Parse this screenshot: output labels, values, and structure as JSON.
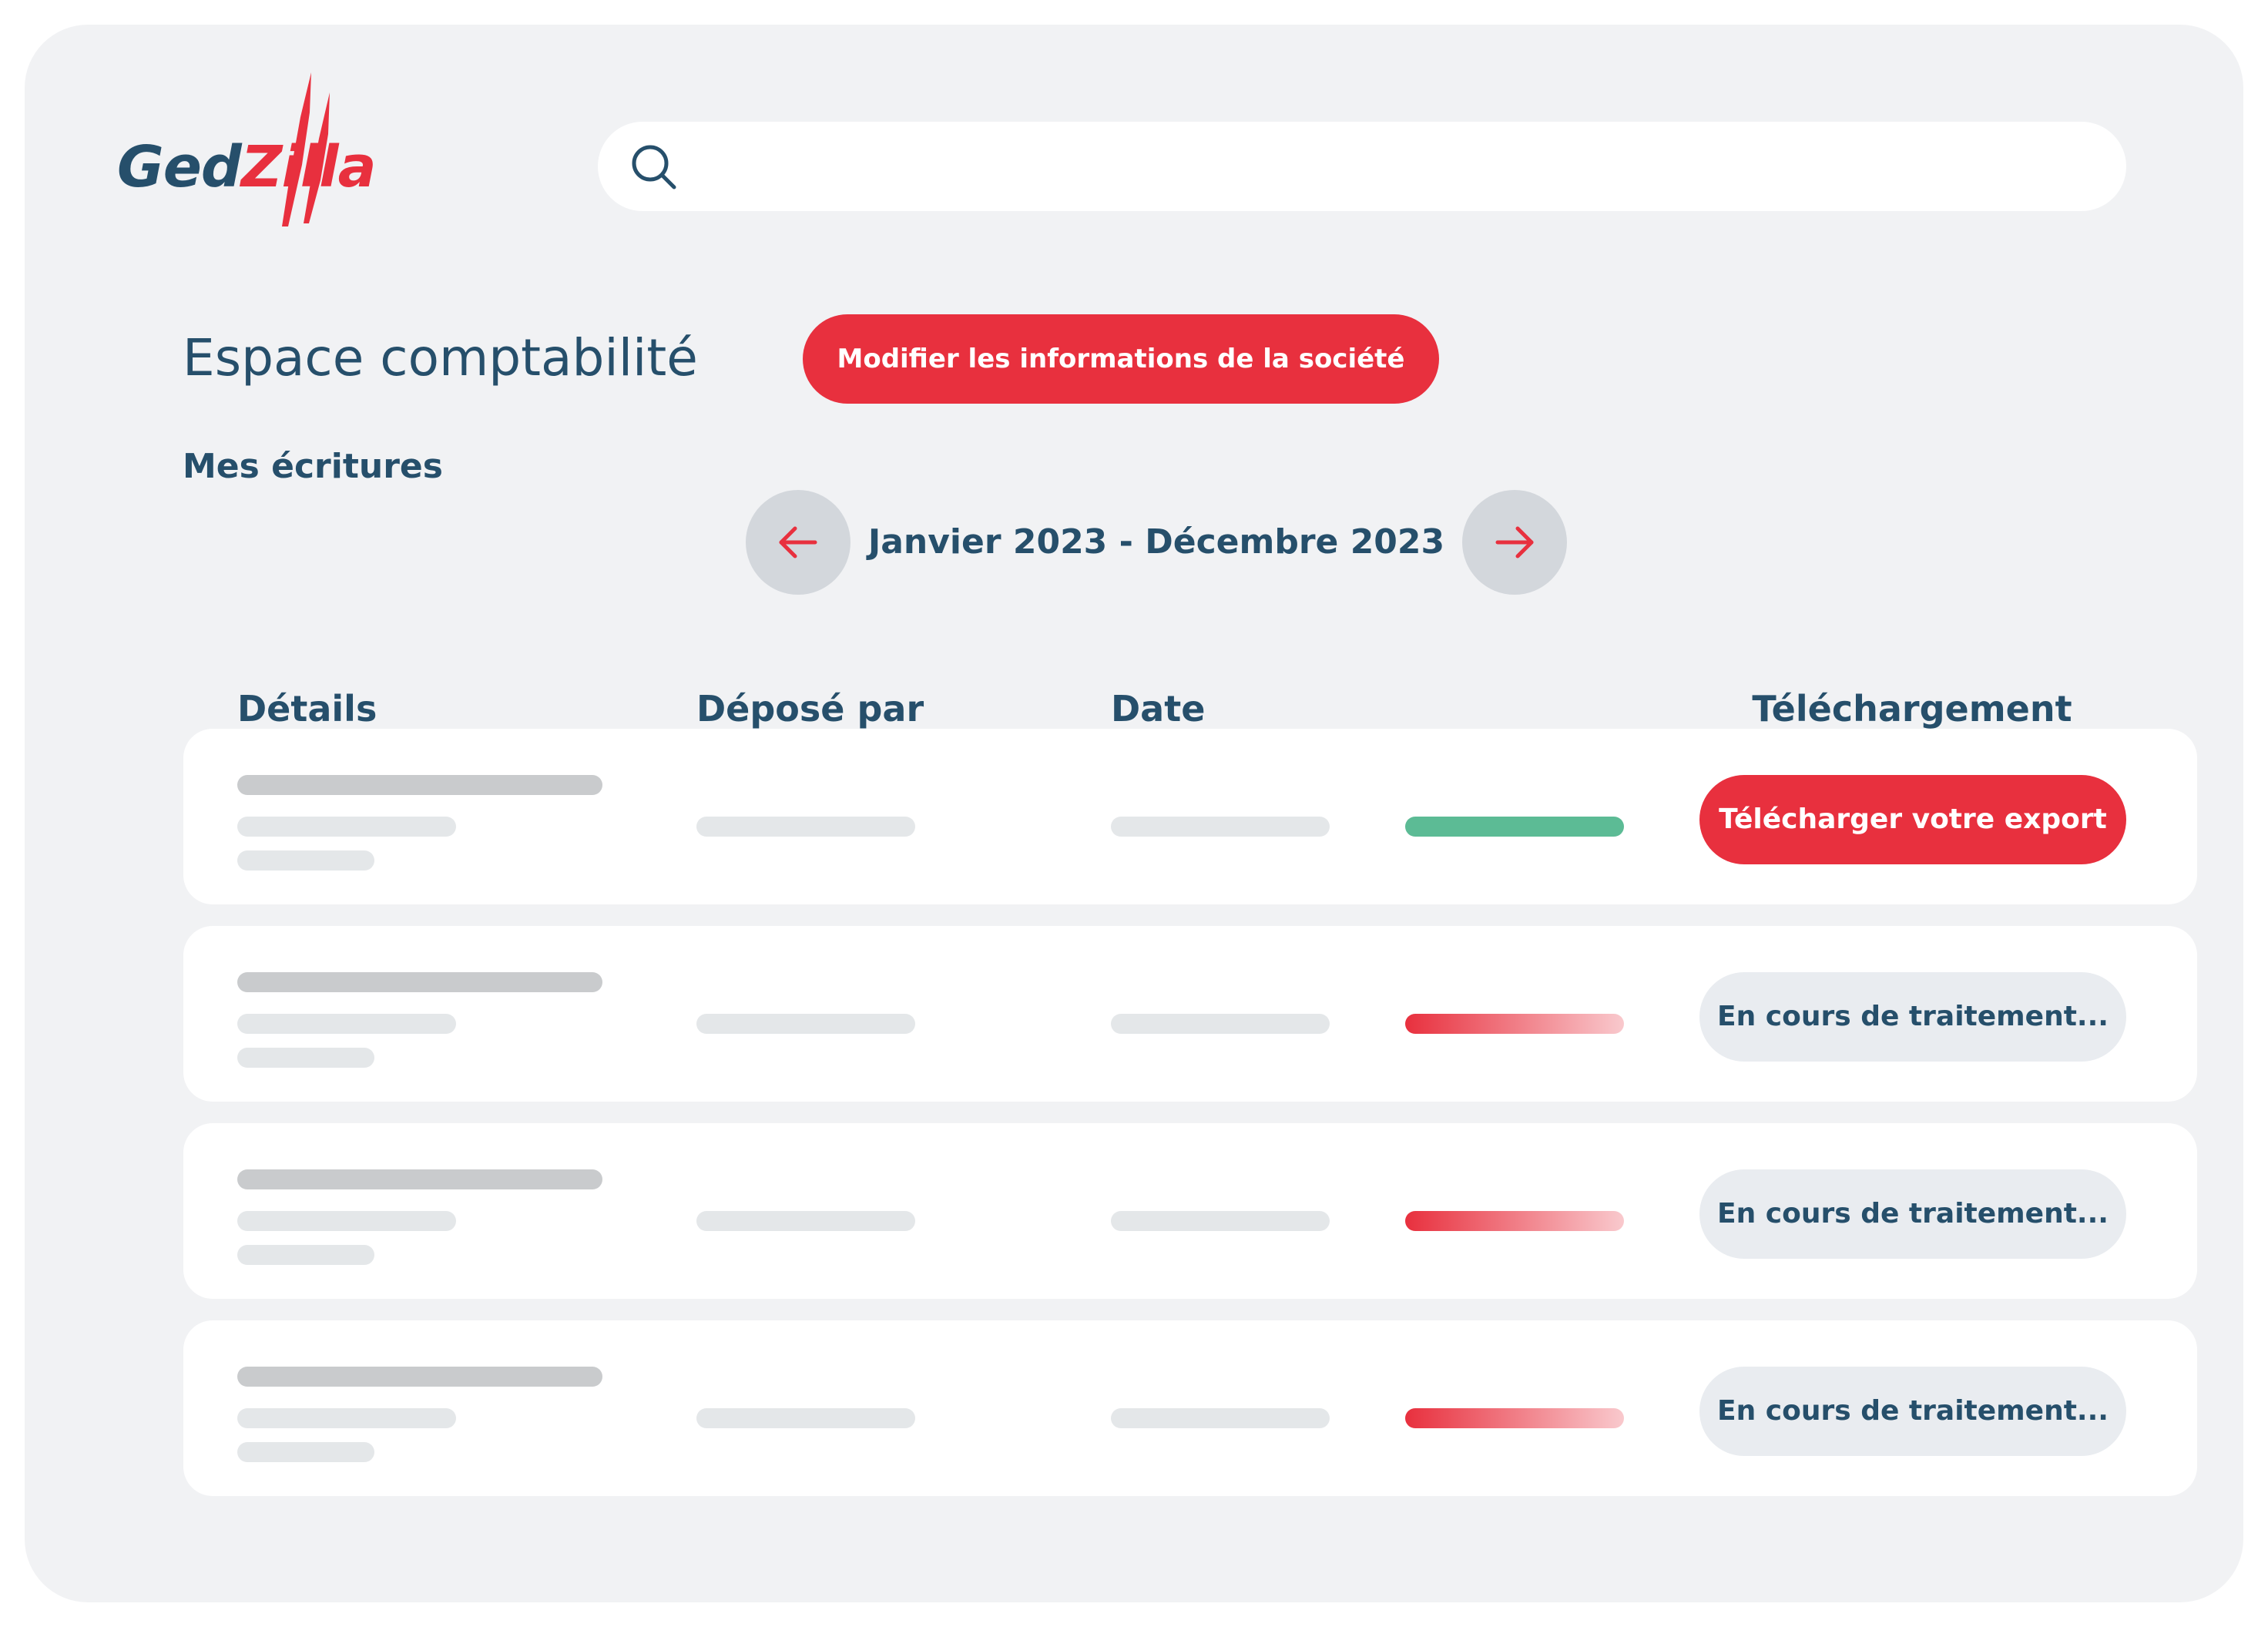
{
  "brand": {
    "logo_part1": "Ged",
    "logo_part2": "Zilla",
    "accent_color": "#e8303e",
    "primary_text_color": "#264f6b"
  },
  "search": {
    "value": "",
    "placeholder": "",
    "icon": "search-icon"
  },
  "header": {
    "title": "Espace comptabilité",
    "edit_button_label": "Modifier les informations de la société",
    "subtitle": "Mes écritures"
  },
  "period": {
    "label": "Janvier 2023 - Décembre 2023",
    "prev_icon": "arrow-left-icon",
    "next_icon": "arrow-right-icon"
  },
  "table": {
    "columns": [
      "Détails",
      "Déposé par",
      "Date",
      "Téléchargement"
    ],
    "rows": [
      {
        "status": "done",
        "status_color": "#5cbb95",
        "action_label": "Télécharger votre export"
      },
      {
        "status": "processing",
        "status_color": "#e8303e",
        "action_label": "En cours de traitement..."
      },
      {
        "status": "processing",
        "status_color": "#e8303e",
        "action_label": "En cours de traitement..."
      },
      {
        "status": "processing",
        "status_color": "#e8303e",
        "action_label": "En cours de traitement..."
      }
    ]
  }
}
